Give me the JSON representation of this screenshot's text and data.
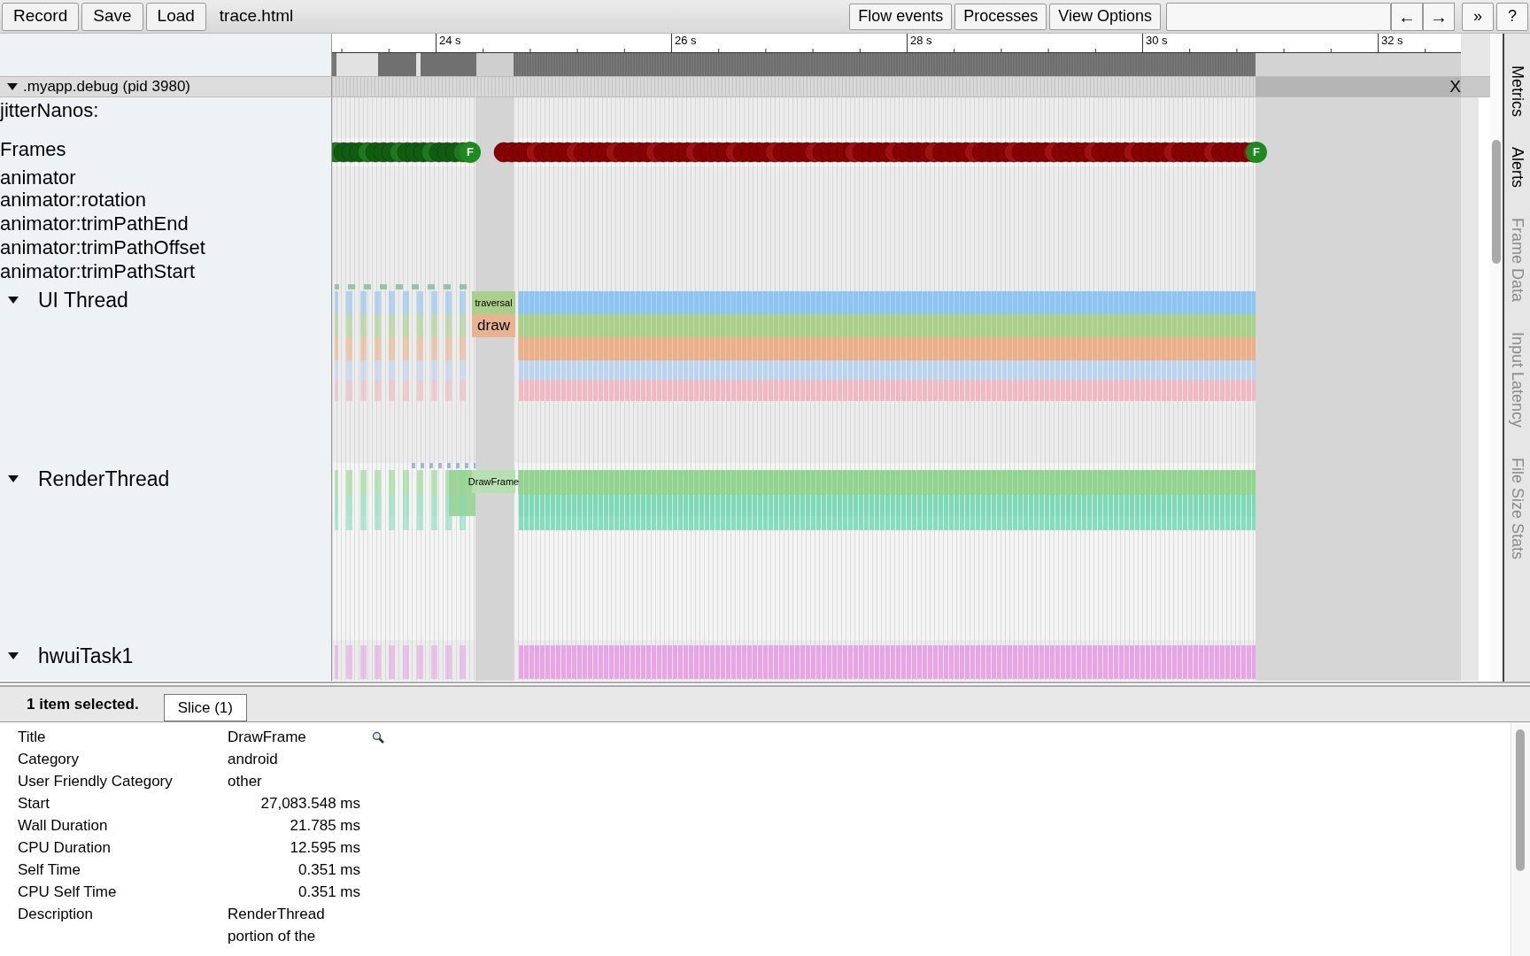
{
  "toolbar": {
    "buttons": [
      "Record",
      "Save",
      "Load"
    ],
    "filename": "trace.html",
    "view_buttons": [
      "Flow events",
      "Processes",
      "View Options"
    ],
    "nav_buttons": [
      "←",
      "→"
    ],
    "more_button": "»",
    "help_button": "?"
  },
  "ruler": {
    "ticks": [
      "24 s",
      "26 s",
      "28 s",
      "30 s",
      "32 s"
    ]
  },
  "process": {
    "title": ".myapp.debug (pid 3980)",
    "expanded": true,
    "close": "X"
  },
  "tracks": [
    {
      "kind": "counter",
      "label": "jitterNanos:"
    },
    {
      "kind": "frames",
      "label": "Frames",
      "markers": [
        "F",
        "F"
      ]
    },
    {
      "kind": "async",
      "label": "animator"
    },
    {
      "kind": "async",
      "label": "animator:rotation"
    },
    {
      "kind": "async",
      "label": "animator:trimPathEnd"
    },
    {
      "kind": "async",
      "label": "animator:trimPathOffset"
    },
    {
      "kind": "async",
      "label": "animator:trimPathStart"
    },
    {
      "kind": "ui_thread",
      "label": "UI Thread",
      "expanded": true,
      "slices": [
        "traversal",
        "draw"
      ]
    },
    {
      "kind": "render_thread",
      "label": "RenderThread",
      "expanded": true,
      "slices": [
        "DrawFrame"
      ]
    },
    {
      "kind": "worker",
      "label": "hwuiTask1",
      "expanded": true
    }
  ],
  "side_tabs": [
    {
      "label": "Metrics",
      "disabled": false
    },
    {
      "label": "Alerts",
      "disabled": false
    },
    {
      "label": "Frame Data",
      "disabled": true
    },
    {
      "label": "Input Latency",
      "disabled": true
    },
    {
      "label": "File Size Stats",
      "disabled": true
    }
  ],
  "details": {
    "summary": "1 item selected.",
    "tabs": [
      {
        "label": "Slice (1)",
        "selected": true
      }
    ],
    "rows": [
      {
        "label": "Title",
        "kind": "text",
        "value": "DrawFrame",
        "searchable": true
      },
      {
        "label": "Category",
        "kind": "text",
        "value": "android"
      },
      {
        "label": "User Friendly Category",
        "kind": "text",
        "value": "other"
      },
      {
        "label": "Start",
        "kind": "number",
        "value": "27,083.548 ms"
      },
      {
        "label": "Wall Duration",
        "kind": "number",
        "value": "21.785 ms"
      },
      {
        "label": "CPU Duration",
        "kind": "number",
        "value": "12.595 ms"
      },
      {
        "label": "Self Time",
        "kind": "number",
        "value": "0.351 ms"
      },
      {
        "label": "CPU Self Time",
        "kind": "number",
        "value": "0.351 ms"
      },
      {
        "label": "Description",
        "kind": "text",
        "value": "RenderThread portion of the"
      }
    ]
  }
}
